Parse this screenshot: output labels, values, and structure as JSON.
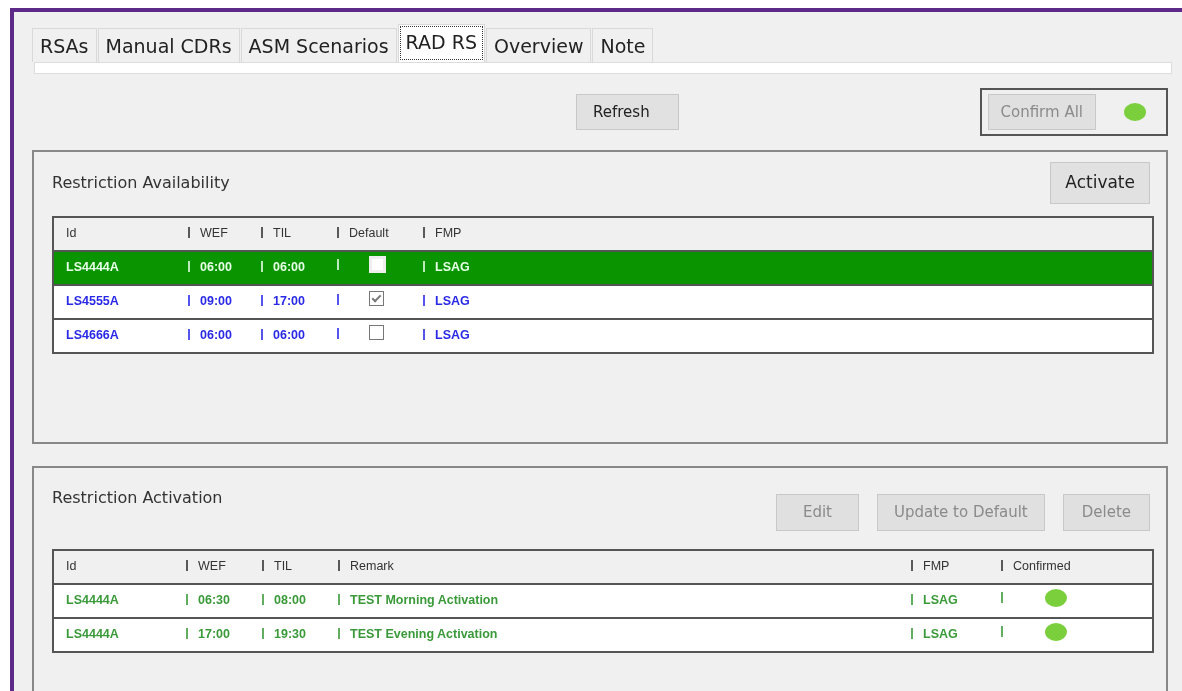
{
  "tabs": [
    {
      "label": "RSAs",
      "selected": false
    },
    {
      "label": "Manual CDRs",
      "selected": false
    },
    {
      "label": "ASM Scenarios",
      "selected": false
    },
    {
      "label": "RAD RS",
      "selected": true
    },
    {
      "label": "Overview",
      "selected": false
    },
    {
      "label": "Note",
      "selected": false
    }
  ],
  "toolbar": {
    "refresh": {
      "label": "Refresh",
      "disabled": false
    },
    "confirm_all": {
      "label": "Confirm All",
      "disabled": true
    },
    "indicator": {
      "on": true
    }
  },
  "availability": {
    "title": "Restriction Availability",
    "activate": {
      "label": "Activate",
      "disabled": false
    },
    "columns": [
      "Id",
      "WEF",
      "TIL",
      "Default",
      "FMP"
    ],
    "rows": [
      {
        "id": "LS4444A",
        "wef": "06:00",
        "til": "06:00",
        "default": false,
        "fmp": "LSAG",
        "selected": true
      },
      {
        "id": "LS4555A",
        "wef": "09:00",
        "til": "17:00",
        "default": true,
        "fmp": "LSAG",
        "selected": false
      },
      {
        "id": "LS4666A",
        "wef": "06:00",
        "til": "06:00",
        "default": false,
        "fmp": "LSAG",
        "selected": false
      }
    ]
  },
  "activation": {
    "title": "Restriction Activation",
    "buttons": [
      {
        "label": "Edit",
        "disabled": true
      },
      {
        "label": "Update to Default",
        "disabled": true
      },
      {
        "label": "Delete",
        "disabled": true
      }
    ],
    "columns": [
      "Id",
      "WEF",
      "TIL",
      "Remark",
      "FMP",
      "Confirmed"
    ],
    "rows": [
      {
        "id": "LS4444A",
        "wef": "06:30",
        "til": "08:00",
        "remark": "TEST Morning Activation",
        "fmp": "LSAG",
        "confirmed": true
      },
      {
        "id": "LS4444A",
        "wef": "17:00",
        "til": "19:30",
        "remark": "TEST Evening Activation",
        "fmp": "LSAG",
        "confirmed": true
      }
    ]
  }
}
